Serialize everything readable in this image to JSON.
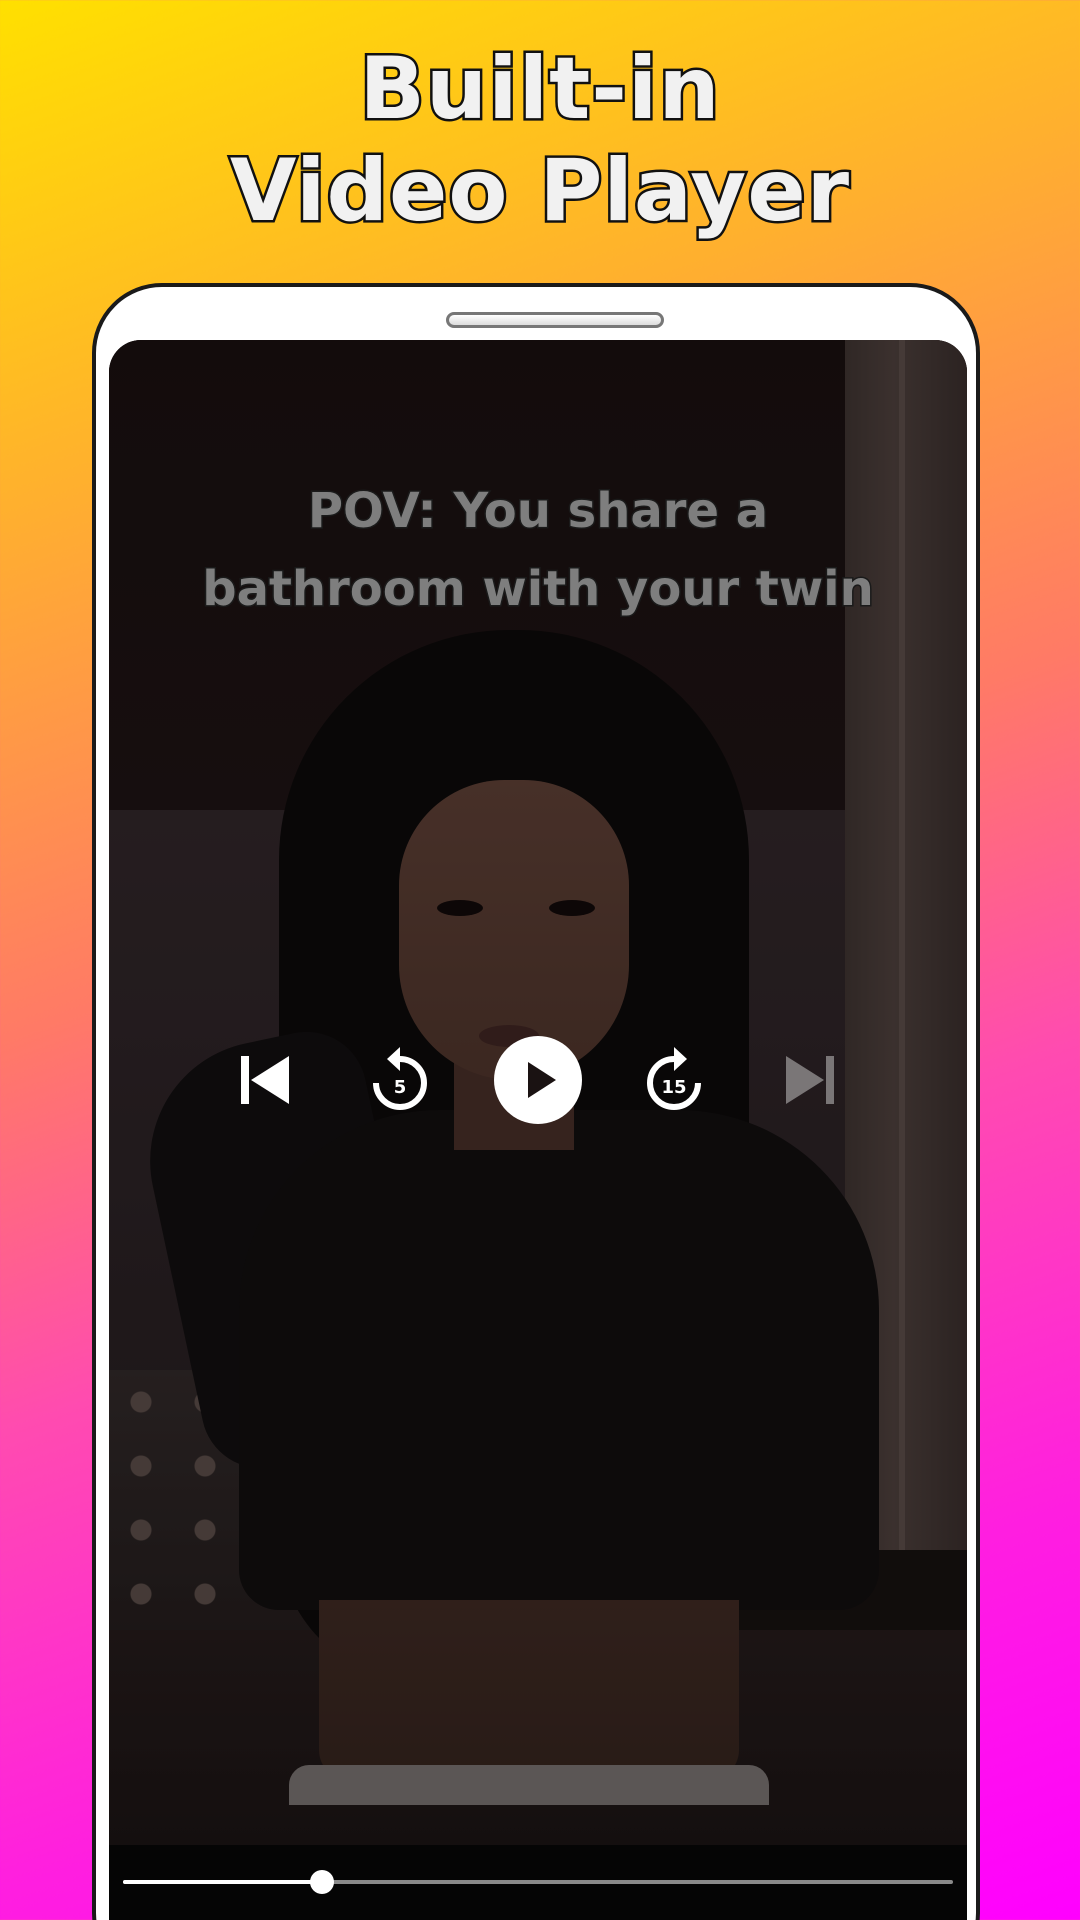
{
  "headline": {
    "line1": "Built-in",
    "line2": "Video Player"
  },
  "video": {
    "caption_line1": "POV: You share a",
    "caption_line2": "bathroom with your twin"
  },
  "controls": {
    "previous_icon": "skip-previous-icon",
    "rewind_icon": "replay-5-icon",
    "rewind_seconds": "5",
    "play_icon": "play-icon",
    "forward_icon": "forward-15-icon",
    "forward_seconds": "15",
    "next_icon": "skip-next-icon",
    "next_enabled": false
  },
  "seekbar": {
    "progress": 0.24
  },
  "colors": {
    "background_gradient": [
      "#ffe000",
      "#ffb02e",
      "#ff4bb0",
      "#ff00ff"
    ],
    "headline_fill": "#f1f1f1",
    "headline_stroke": "#111111",
    "control_color": "#ffffff"
  }
}
